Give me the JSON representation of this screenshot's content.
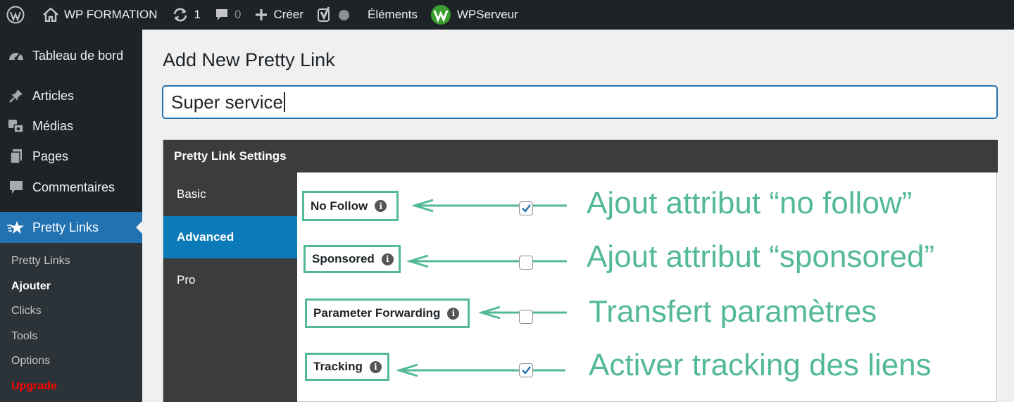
{
  "adminbar": {
    "site_name": "WP FORMATION",
    "updates_count": "1",
    "comments_count": "0",
    "new_label": "Créer",
    "elements_label": "Éléments",
    "wpserveur_label": "WPServeur"
  },
  "sidebar": {
    "items": [
      {
        "label": "Tableau de bord",
        "icon": "dashboard-icon"
      },
      {
        "label": "Articles",
        "icon": "pin-icon"
      },
      {
        "label": "Médias",
        "icon": "media-icon"
      },
      {
        "label": "Pages",
        "icon": "pages-icon"
      },
      {
        "label": "Commentaires",
        "icon": "comment-icon"
      },
      {
        "label": "Pretty Links",
        "icon": "star-icon"
      }
    ],
    "submenu": [
      "Pretty Links",
      "Ajouter",
      "Clicks",
      "Tools",
      "Options",
      "Upgrade"
    ]
  },
  "main": {
    "page_title": "Add New Pretty Link",
    "title_value": "Super service",
    "panel_title": "Pretty Link Settings",
    "tabs": [
      "Basic",
      "Advanced",
      "Pro"
    ],
    "options": [
      {
        "label": "No Follow",
        "checked": true,
        "annotation": "Ajout attribut “no follow”"
      },
      {
        "label": "Sponsored",
        "checked": false,
        "annotation": "Ajout attribut “sponsored”"
      },
      {
        "label": "Parameter Forwarding",
        "checked": false,
        "annotation": "Transfert paramètres"
      },
      {
        "label": "Tracking",
        "checked": true,
        "annotation": "Activer tracking des liens"
      }
    ]
  },
  "colors": {
    "admin_bg": "#1d2327",
    "accent": "#2271b1",
    "annotation": "#53b996",
    "upgrade": "#ff0000"
  }
}
